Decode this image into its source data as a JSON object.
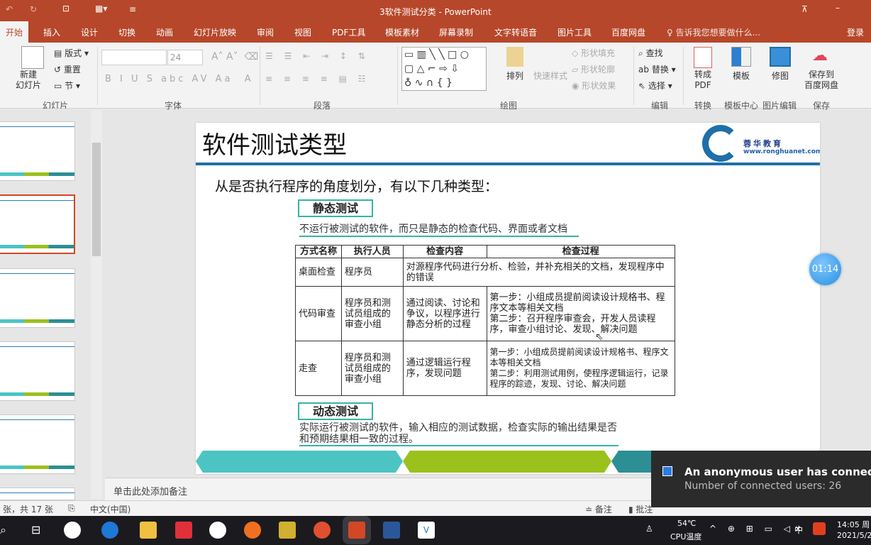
{
  "window": {
    "title": "3软件测试分类 - PowerPoint",
    "login": "登录"
  },
  "tabs": [
    "开始",
    "插入",
    "设计",
    "切换",
    "动画",
    "幻灯片放映",
    "审阅",
    "视图",
    "PDF工具",
    "模板素材",
    "屏幕录制",
    "文字转语音",
    "图片工具",
    "百度网盘"
  ],
  "tell_me": "告诉我您想要做什么...",
  "ribbon": {
    "slides": {
      "new_slide": "新建\n幻灯片",
      "layout": "版式",
      "reset": "重置",
      "section": "节",
      "group": "幻灯片"
    },
    "font": {
      "font_name": "",
      "font_size": "24",
      "group": "字体"
    },
    "paragraph": {
      "group": "段落"
    },
    "drawing": {
      "arrange": "排列",
      "quick_styles": "快速样式",
      "shape_fill": "形状填充",
      "shape_outline": "形状轮廓",
      "shape_effects": "形状效果",
      "group": "绘图"
    },
    "editing": {
      "find": "查找",
      "replace": "替换",
      "select": "选择",
      "group": "编辑"
    },
    "convert": {
      "to_pdf": "转成\nPDF",
      "group": "转换"
    },
    "template": {
      "label": "模板",
      "group": "模板中心"
    },
    "picture": {
      "label": "修图",
      "group": "图片编辑"
    },
    "save": {
      "label": "保存到\n百度网盘",
      "group": "保存"
    }
  },
  "slide": {
    "title": "软件测试类型",
    "logo_name": "蓉华教育",
    "logo_url": "www.ronghuanet.com",
    "subtitle": "从是否执行程序的角度划分，有以下几种类型：",
    "static": {
      "heading": "静态测试",
      "desc": "不运行被测试的软件，而只是静态的检查代码、界面或者文档"
    },
    "table": {
      "headers": [
        "方式名称",
        "执行人员",
        "检查内容",
        "检查过程"
      ],
      "rows": [
        {
          "name": "桌面检查",
          "who": "程序员",
          "content": "对源程序代码进行分析、检验，并补充相关的文档，发现程序中的错误",
          "process": ""
        },
        {
          "name": "代码审查",
          "who": "程序员和测试员组成的审查小组",
          "content": "通过阅读、讨论和争议，以程序进行静态分析的过程",
          "process": "第一步：小组成员提前阅读设计规格书、程序文本等相关文档\n第二步：召开程序审查会，开发人员读程序，审查小组讨论、发现、解决问题"
        },
        {
          "name": "走查",
          "who": "程序员和测试员组成的审查小组",
          "content": "通过逻辑运行程序，发现问题",
          "process": "第一步：小组成员提前阅读设计规格书、程序文本等相关文档\n第二步：利用测试用例，使程序逻辑运行，记录程序的踪迹，发现、讨论、解决问题"
        }
      ]
    },
    "dynamic": {
      "heading": "动态测试",
      "desc": "实际运行被测试的软件，输入相应的测试数据，检查实际的输出结果是否和预期结果相一致的过程。"
    }
  },
  "timer": "01:14",
  "notes_placeholder": "单击此处添加备注",
  "status": {
    "slide_count": "张，共 17 张",
    "language": "中文(中国)",
    "notes": "备注",
    "comments": "批注"
  },
  "toast": {
    "title": "An anonymous user has connected",
    "body": "Number of connected users: 26"
  },
  "tray": {
    "temp": "54℃",
    "temp_label": "CPU温度",
    "ime": "中",
    "time": "14:05 周",
    "date": "2021/5/2"
  },
  "colors": {
    "accent": "#b7472a",
    "teal": "#34b5a6",
    "green": "#9ac11c",
    "slide_blue": "#1f6fa8"
  }
}
